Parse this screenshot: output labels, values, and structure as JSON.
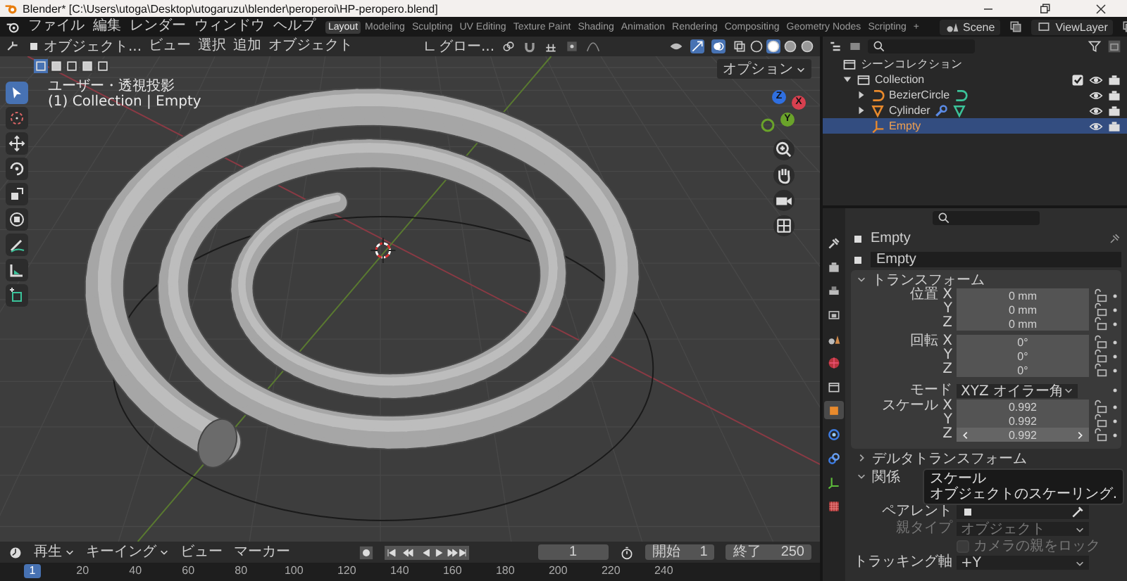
{
  "title_bar": {
    "title": "Blender* [C:\\Users\\utoga\\Desktop\\utogaruzu\\blender\\peroperoi\\HP-peropero.blend]"
  },
  "top_bar": {
    "menu": [
      "ファイル",
      "編集",
      "レンダー",
      "ウィンドウ",
      "ヘルプ"
    ],
    "workspaces": [
      {
        "label": "Layout",
        "selected": true
      },
      {
        "label": "Modeling",
        "selected": false
      },
      {
        "label": "Sculpting",
        "selected": false
      },
      {
        "label": "UV Editing",
        "selected": false
      },
      {
        "label": "Texture Paint",
        "selected": false
      },
      {
        "label": "Shading",
        "selected": false
      },
      {
        "label": "Animation",
        "selected": false
      },
      {
        "label": "Rendering",
        "selected": false
      },
      {
        "label": "Compositing",
        "selected": false
      },
      {
        "label": "Geometry Nodes",
        "selected": false
      },
      {
        "label": "Scripting",
        "selected": false
      }
    ],
    "add_workspace": "+",
    "scene": "Scene",
    "view_layer": "ViewLayer"
  },
  "viewport": {
    "mode": "オブジェクト...",
    "menu": [
      "ビュー",
      "選択",
      "追加",
      "オブジェクト"
    ],
    "orientation": "グロー...",
    "options": "オプション",
    "view_name": "ユーザー・透視投影",
    "context": "(1) Collection | Empty",
    "select_modes": [
      {
        "selected": true
      },
      {
        "selected": false
      },
      {
        "selected": false
      },
      {
        "selected": false
      },
      {
        "selected": false
      }
    ],
    "shading_modes": [
      {
        "selected": false
      },
      {
        "selected": true
      },
      {
        "selected": false
      },
      {
        "selected": false
      }
    ],
    "tools": [
      {
        "kind": "select",
        "selected": true
      },
      {
        "kind": "cursor",
        "selected": false
      },
      {
        "kind": "move",
        "selected": false
      },
      {
        "kind": "rotate",
        "selected": false
      },
      {
        "kind": "scale",
        "selected": false
      },
      {
        "kind": "transform",
        "selected": false
      },
      {
        "kind": "annotate",
        "selected": false
      },
      {
        "kind": "measure",
        "selected": false
      },
      {
        "kind": "add-cube",
        "selected": false
      }
    ],
    "gizmo_axes": [
      {
        "label": "Z",
        "color": "#2f6fe0"
      },
      {
        "label": "X",
        "color": "#d8404f"
      },
      {
        "label": "Y",
        "color": "#6aa32a"
      }
    ]
  },
  "outliner": {
    "items": [
      {
        "label": "シーンコレクション",
        "kind": "scene-collection",
        "selected": false,
        "children": [
          {
            "label": "Collection",
            "kind": "collection",
            "selected": false,
            "expanded": true,
            "checked": true,
            "visible": true,
            "children": [
              {
                "label": "BezierCircle",
                "kind": "curve",
                "selected": false,
                "expanded": false,
                "visible": true,
                "extras": [
                  {
                    "kind": "curve-data"
                  }
                ]
              },
              {
                "label": "Cylinder",
                "kind": "mesh",
                "selected": false,
                "expanded": false,
                "visible": true,
                "extras": [
                  {
                    "kind": "modifier"
                  },
                  {
                    "kind": "mesh-data"
                  }
                ]
              },
              {
                "label": "Empty",
                "kind": "empty",
                "selected": true,
                "visible": true
              }
            ]
          }
        ]
      }
    ]
  },
  "properties": {
    "tabs": [
      {
        "kind": "tool",
        "selected": false
      },
      {
        "kind": "render",
        "selected": false
      },
      {
        "kind": "output",
        "selected": false
      },
      {
        "kind": "view-layer",
        "selected": false
      },
      {
        "kind": "scene",
        "selected": false
      },
      {
        "kind": "world",
        "selected": false
      },
      {
        "kind": "collection",
        "selected": false
      },
      {
        "kind": "object",
        "selected": true
      },
      {
        "kind": "physics",
        "selected": false
      },
      {
        "kind": "constraints",
        "selected": false
      },
      {
        "kind": "data",
        "selected": false
      },
      {
        "kind": "texture",
        "selected": false
      }
    ],
    "object": "Empty",
    "data_name": "Empty",
    "transform": {
      "label": "トランスフォーム",
      "expanded": true,
      "groups": [
        {
          "label": "位置",
          "rows": [
            {
              "axis": "X",
              "value": "0 mm",
              "hover": false
            },
            {
              "axis": "Y",
              "value": "0 mm",
              "hover": false
            },
            {
              "axis": "Z",
              "value": "0 mm",
              "hover": false
            }
          ]
        },
        {
          "label": "回転",
          "rows": [
            {
              "axis": "X",
              "value": "0°",
              "hover": false
            },
            {
              "axis": "Y",
              "value": "0°",
              "hover": false
            },
            {
              "axis": "Z",
              "value": "0°",
              "hover": false
            }
          ]
        },
        {
          "label": "スケール",
          "rows": [
            {
              "axis": "X",
              "value": "0.992",
              "hover": false
            },
            {
              "axis": "Y",
              "value": "0.992",
              "hover": false
            },
            {
              "axis": "Z",
              "value": "0.992",
              "hover": true
            }
          ]
        }
      ],
      "mode_label": "モード",
      "mode_value": "XYZ オイラー角"
    },
    "delta": {
      "label": "デルタトランスフォーム",
      "expanded": false
    },
    "relations": {
      "label": "関係",
      "expanded": true,
      "parent_label": "ペアレント",
      "parent_type_label": "親タイプ",
      "parent_type_value": "オブジェクト",
      "parent_type_disabled": true,
      "camera_lock_label": "カメラの親をロック",
      "camera_lock_checked": false,
      "camera_lock_disabled": true,
      "tracking_label": "トラッキング軸",
      "tracking_value": "+Y"
    },
    "tooltip": {
      "title": "スケール",
      "description": "オブジェクトのスケーリング."
    }
  },
  "timeline": {
    "menus": [
      "再生",
      "キーイング",
      "ビュー",
      "マーカー"
    ],
    "current_frame": "1",
    "start_label": "開始",
    "start": "1",
    "end_label": "終了",
    "end": "250",
    "marker": "1",
    "ticks": [
      "20",
      "40",
      "60",
      "80",
      "100",
      "120",
      "140",
      "160",
      "180",
      "200",
      "220",
      "240"
    ]
  }
}
